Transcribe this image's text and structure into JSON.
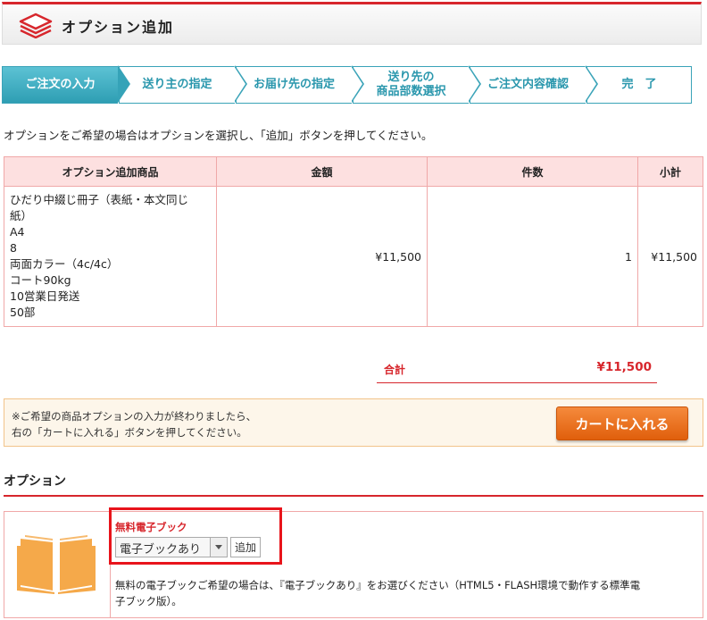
{
  "header": {
    "title": "オプション追加"
  },
  "steps": [
    {
      "label": "ご注文の入力",
      "active": true
    },
    {
      "label": "送り主の指定",
      "active": false
    },
    {
      "label": "お届け先の指定",
      "active": false
    },
    {
      "label": "送り先の\n商品部数選択",
      "active": false
    },
    {
      "label": "ご注文内容確認",
      "active": false
    },
    {
      "label": "完　了",
      "active": false
    }
  ],
  "intro": "オプションをご希望の場合はオプションを選択し、「追加」ボタンを押してください。",
  "table": {
    "headers": [
      "オプション追加商品",
      "金額",
      "件数",
      "小計"
    ],
    "rows": [
      {
        "desc_lines": [
          "ひだり中綴じ冊子（表紙・本文同じ",
          "紙）",
          "A4",
          "8",
          "両面カラー（4c/4c）",
          "コート90kg",
          "10営業日発送",
          "50部"
        ],
        "price": "¥11,500",
        "qty": "1",
        "subtotal": "¥11,500"
      }
    ]
  },
  "total": {
    "label": "合計",
    "value": "¥11,500"
  },
  "notice": {
    "line1": "※ご希望の商品オプションの入力が終わりましたら、",
    "line2": "右の「カートに入れる」ボタンを押してください。",
    "cart_button": "カートに入れる"
  },
  "options": {
    "heading": "オプション",
    "item": {
      "title": "無料電子ブック",
      "selected": "電子ブックあり",
      "add_button": "追加",
      "desc_line1": "無料の電子ブックご希望の場合は、『電子ブックあり』をお選びください（HTML5・FLASH環境で動作する標準電",
      "desc_line2": "子ブック版）。"
    }
  },
  "colors": {
    "accent": "#d7262c",
    "step": "#2e9eb3",
    "cart": "#e8701c",
    "book": "#f5a94a"
  }
}
